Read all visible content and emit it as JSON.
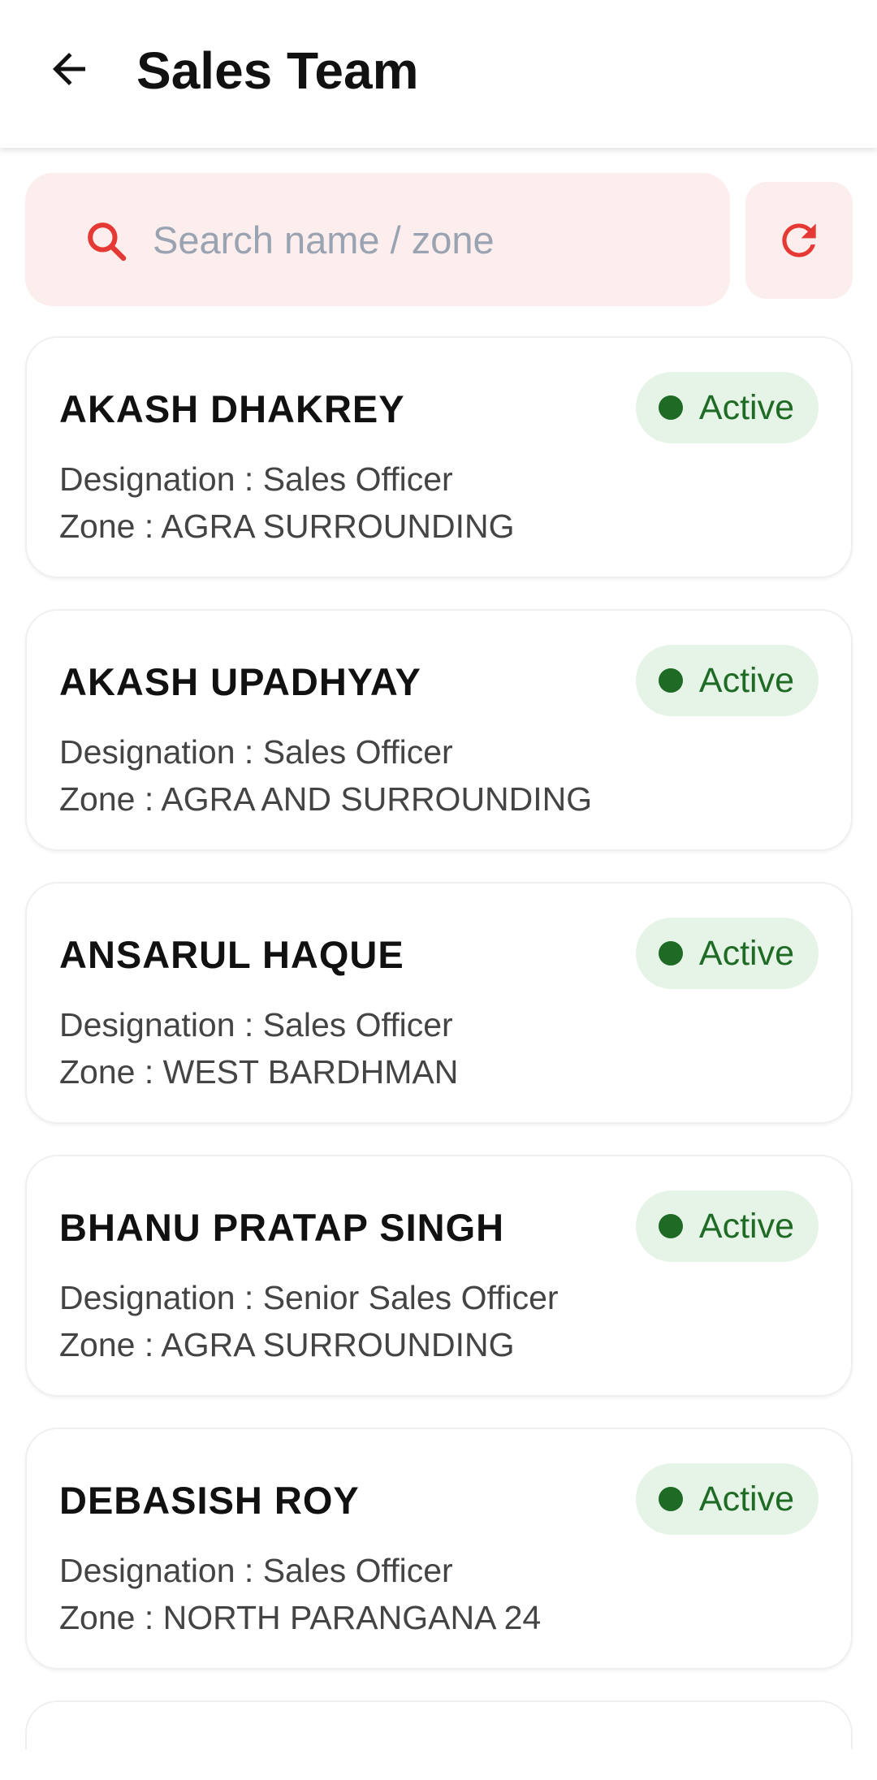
{
  "header": {
    "title": "Sales Team",
    "back_icon": "arrow-left-icon"
  },
  "search": {
    "placeholder": "Search name / zone",
    "value": "",
    "icon": "search-icon",
    "refresh_icon": "refresh-icon"
  },
  "colors": {
    "accent": "#e53935",
    "search_bg": "#fdeeee",
    "active_text": "#1f6b25",
    "active_bg": "#e6f4e8"
  },
  "members": [
    {
      "name": "AKASH DHAKREY",
      "status": "Active",
      "designation": "Designation : Sales Officer",
      "zone": "Zone : AGRA SURROUNDING"
    },
    {
      "name": "AKASH UPADHYAY",
      "status": "Active",
      "designation": "Designation : Sales Officer",
      "zone": "Zone : AGRA AND SURROUNDING"
    },
    {
      "name": "ANSARUL HAQUE",
      "status": "Active",
      "designation": "Designation : Sales Officer",
      "zone": "Zone : WEST BARDHMAN"
    },
    {
      "name": "BHANU PRATAP SINGH",
      "status": "Active",
      "designation": "Designation : Senior Sales Officer",
      "zone": "Zone : AGRA SURROUNDING"
    },
    {
      "name": "DEBASISH ROY",
      "status": "Active",
      "designation": "Designation : Sales Officer",
      "zone": "Zone : NORTH PARANGANA 24"
    }
  ]
}
